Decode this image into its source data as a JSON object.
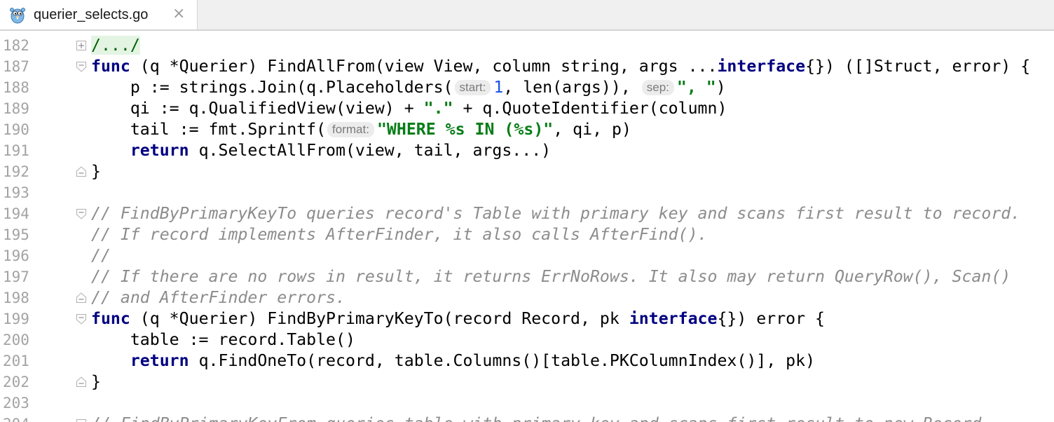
{
  "tab": {
    "filename": "querier_selects.go",
    "close_glyph": "×",
    "icon": "gopher-icon"
  },
  "lines": [
    {
      "num": "182",
      "fold": "plus",
      "tokens": [
        {
          "t": "/.../",
          "c": "fr"
        }
      ]
    },
    {
      "num": "187",
      "fold": "open",
      "tokens": [
        {
          "t": "func",
          "c": "k"
        },
        {
          "t": " (q *Querier) FindAllFrom(view View, column string, args ..."
        },
        {
          "t": "interface",
          "c": "k"
        },
        {
          "t": "{}) ([]Struct, error) {"
        }
      ]
    },
    {
      "num": "188",
      "fold": "",
      "tokens": [
        {
          "t": "    p := strings.Join(q.Placeholders("
        },
        {
          "t": "start:",
          "c": "hint"
        },
        {
          "t": "1",
          "c": "n"
        },
        {
          "t": ", len(args)), "
        },
        {
          "t": "sep:",
          "c": "hint"
        },
        {
          "t": "\", \"",
          "c": "s"
        },
        {
          "t": ")"
        }
      ]
    },
    {
      "num": "189",
      "fold": "",
      "tokens": [
        {
          "t": "    qi := q.QualifiedView(view) + "
        },
        {
          "t": "\".\"",
          "c": "s"
        },
        {
          "t": " + q.QuoteIdentifier(column)"
        }
      ]
    },
    {
      "num": "190",
      "fold": "",
      "tokens": [
        {
          "t": "    tail := fmt.Sprintf("
        },
        {
          "t": "format:",
          "c": "hint"
        },
        {
          "t": "\"WHERE %s IN (%s)\"",
          "c": "s"
        },
        {
          "t": ", qi, p)"
        }
      ]
    },
    {
      "num": "191",
      "fold": "",
      "tokens": [
        {
          "t": "    "
        },
        {
          "t": "return",
          "c": "k"
        },
        {
          "t": " q.SelectAllFrom(view, tail, args...)"
        }
      ]
    },
    {
      "num": "192",
      "fold": "close",
      "tokens": [
        {
          "t": "}"
        }
      ]
    },
    {
      "num": "193",
      "fold": "",
      "tokens": []
    },
    {
      "num": "194",
      "fold": "open",
      "tokens": [
        {
          "t": "// FindByPrimaryKeyTo queries record's Table with primary key and scans first result to record.",
          "c": "c"
        }
      ]
    },
    {
      "num": "195",
      "fold": "",
      "tokens": [
        {
          "t": "// If record implements AfterFinder, it also calls AfterFind().",
          "c": "c"
        }
      ]
    },
    {
      "num": "196",
      "fold": "",
      "tokens": [
        {
          "t": "//",
          "c": "c"
        }
      ]
    },
    {
      "num": "197",
      "fold": "",
      "tokens": [
        {
          "t": "// If there are no rows in result, it returns ErrNoRows. It also may return QueryRow(), Scan()",
          "c": "c"
        }
      ]
    },
    {
      "num": "198",
      "fold": "close",
      "tokens": [
        {
          "t": "// and AfterFinder errors.",
          "c": "c"
        }
      ]
    },
    {
      "num": "199",
      "fold": "open",
      "tokens": [
        {
          "t": "func",
          "c": "k"
        },
        {
          "t": " (q *Querier) FindByPrimaryKeyTo(record Record, pk "
        },
        {
          "t": "interface",
          "c": "k"
        },
        {
          "t": "{}) error {"
        }
      ]
    },
    {
      "num": "200",
      "fold": "",
      "tokens": [
        {
          "t": "    table := record.Table()"
        }
      ]
    },
    {
      "num": "201",
      "fold": "",
      "tokens": [
        {
          "t": "    "
        },
        {
          "t": "return",
          "c": "k"
        },
        {
          "t": " q.FindOneTo(record, table.Columns()[table.PKColumnIndex()], pk)"
        }
      ]
    },
    {
      "num": "202",
      "fold": "close",
      "tokens": [
        {
          "t": "}"
        }
      ]
    },
    {
      "num": "203",
      "fold": "",
      "tokens": []
    },
    {
      "num": "204",
      "fold": "open",
      "tokens": [
        {
          "t": "// FindByPrimaryKeyFrom queries table with primary key and scans first result to new Record.",
          "c": "c"
        }
      ]
    }
  ]
}
